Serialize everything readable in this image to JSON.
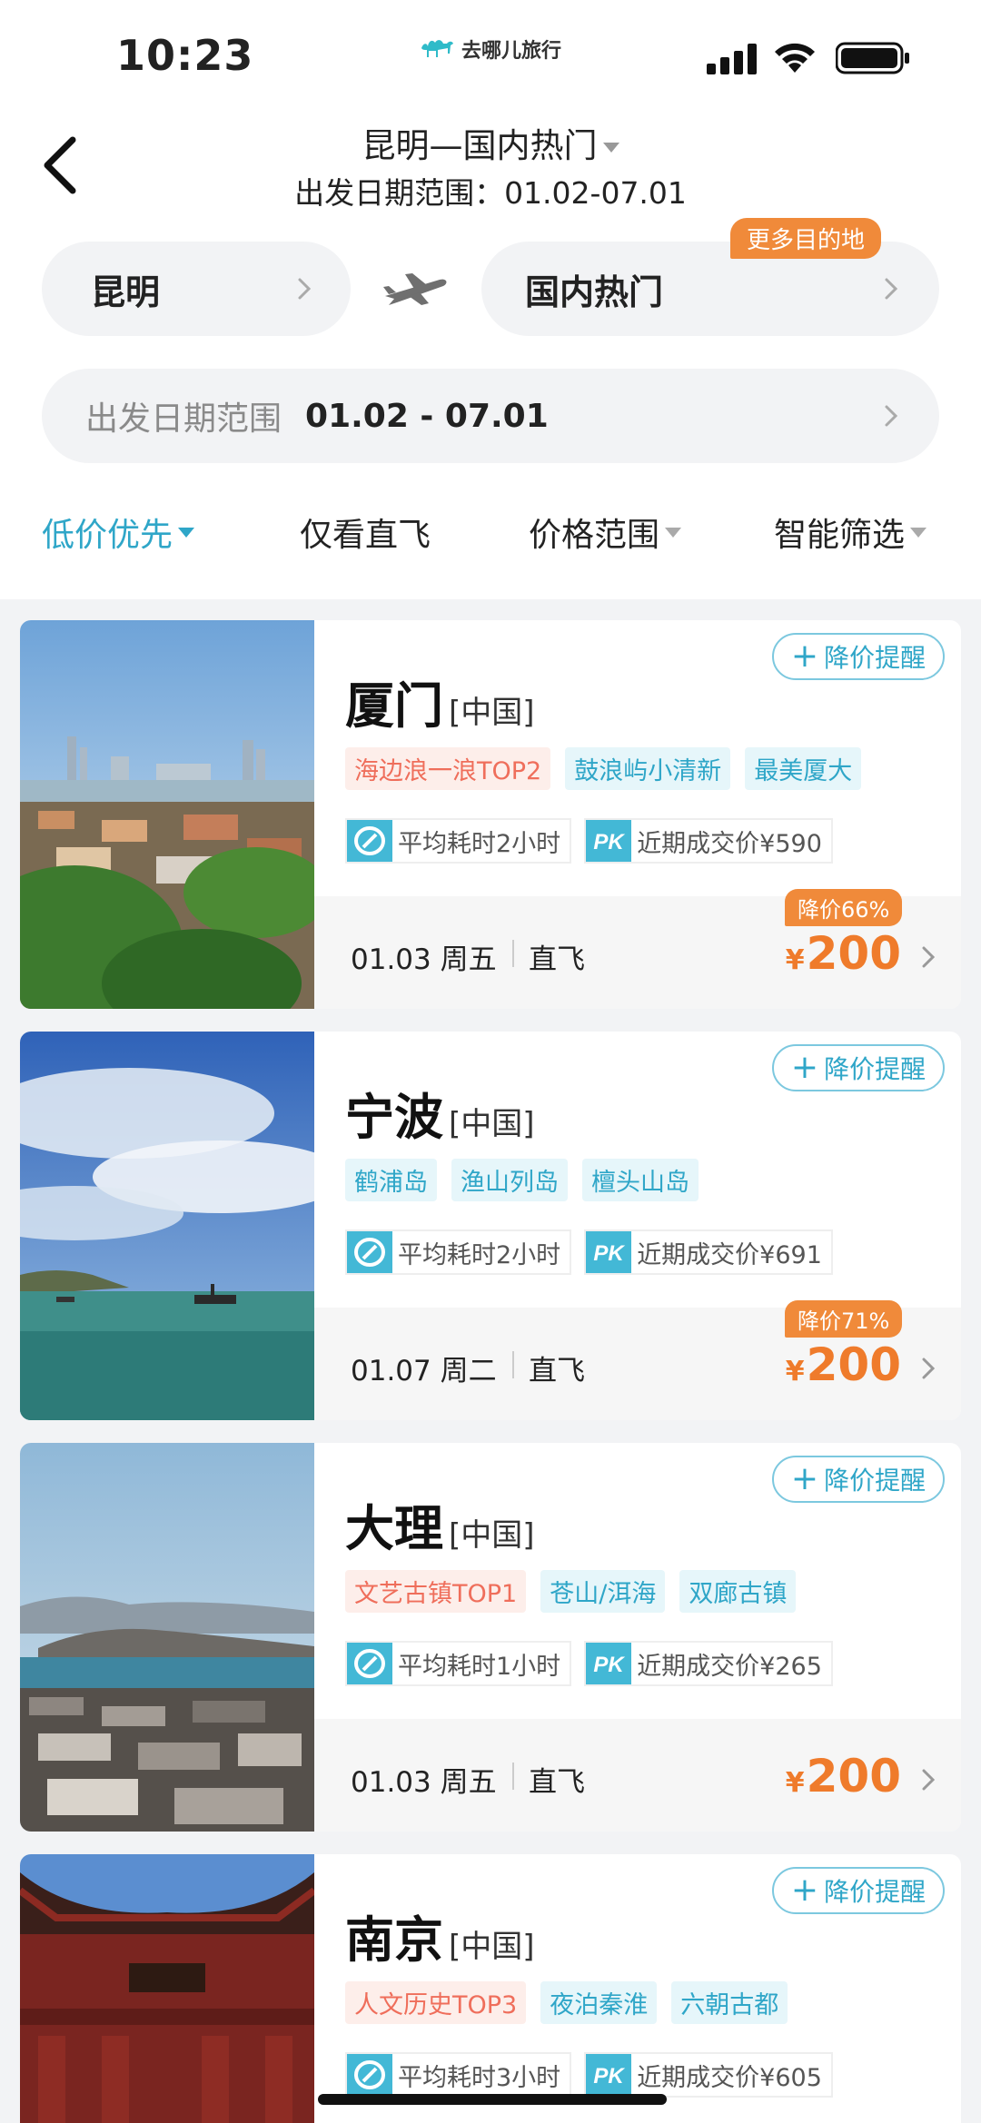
{
  "status_bar": {
    "time": "10:23",
    "app_name": "去哪儿旅行"
  },
  "nav": {
    "title": "昆明—国内热门",
    "subtitle": "出发日期范围：01.02-07.01"
  },
  "search": {
    "from_city": "昆明",
    "to_city": "国内热门",
    "more_badge": "更多目的地",
    "date_label": "出发日期范围",
    "date_value": "01.02 - 07.01"
  },
  "sort_bar": {
    "items": [
      {
        "label": "低价优先",
        "active": true
      },
      {
        "label": "仅看直飞"
      },
      {
        "label": "价格范围"
      },
      {
        "label": "智能筛选"
      }
    ]
  },
  "colors": {
    "accent": "#2fa6c8",
    "price": "#ef7b2b",
    "badge": "#f08a3a",
    "hot_tag": "#ef6e5b"
  },
  "cards": [
    {
      "name": "厦门",
      "country": "[中国]",
      "alert": "降价提醒",
      "tags": [
        {
          "text": "海边浪一浪TOP2",
          "kind": "hot"
        },
        {
          "text": "鼓浪屿小清新",
          "kind": "blue"
        },
        {
          "text": "最美厦大",
          "kind": "blue"
        }
      ],
      "avg_time": "平均耗时2小时",
      "recent_price": "近期成交价¥590",
      "date": "01.03 周五",
      "flight_type": "直飞",
      "discount": "降价66%",
      "price": "200"
    },
    {
      "name": "宁波",
      "country": "[中国]",
      "alert": "降价提醒",
      "tags": [
        {
          "text": "鹤浦岛",
          "kind": "blue"
        },
        {
          "text": "渔山列岛",
          "kind": "blue"
        },
        {
          "text": "檀头山岛",
          "kind": "blue"
        }
      ],
      "avg_time": "平均耗时2小时",
      "recent_price": "近期成交价¥691",
      "date": "01.07 周二",
      "flight_type": "直飞",
      "discount": "降价71%",
      "price": "200"
    },
    {
      "name": "大理",
      "country": "[中国]",
      "alert": "降价提醒",
      "tags": [
        {
          "text": "文艺古镇TOP1",
          "kind": "hot"
        },
        {
          "text": "苍山/洱海",
          "kind": "blue"
        },
        {
          "text": "双廊古镇",
          "kind": "blue"
        }
      ],
      "avg_time": "平均耗时1小时",
      "recent_price": "近期成交价¥265",
      "date": "01.03 周五",
      "flight_type": "直飞",
      "discount": "",
      "price": "200"
    },
    {
      "name": "南京",
      "country": "[中国]",
      "alert": "降价提醒",
      "tags": [
        {
          "text": "人文历史TOP3",
          "kind": "hot"
        },
        {
          "text": "夜泊秦淮",
          "kind": "blue"
        },
        {
          "text": "六朝古都",
          "kind": "blue"
        }
      ],
      "avg_time": "平均耗时3小时",
      "recent_price": "近期成交价¥605",
      "date": "",
      "flight_type": "",
      "discount": "",
      "price": ""
    }
  ],
  "price_currency": "¥"
}
